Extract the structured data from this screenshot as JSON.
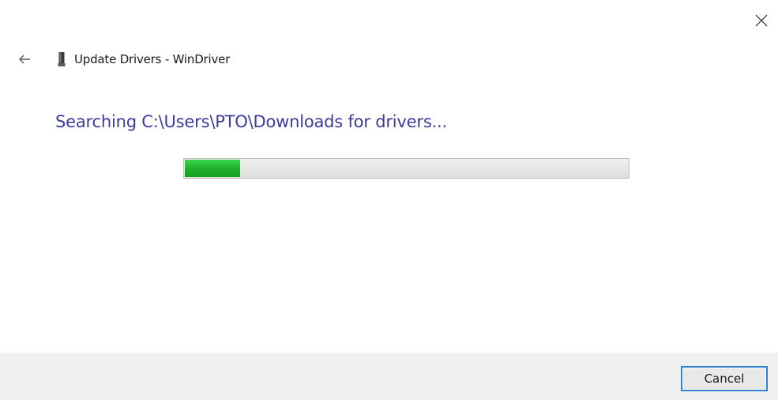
{
  "window": {
    "title": "Update Drivers - WinDriver",
    "close_icon": "close-icon",
    "back_icon": "back-arrow-icon",
    "device_icon": "device-icon"
  },
  "main": {
    "status_text": "Searching C:\\Users\\PTO\\Downloads for drivers...",
    "progress_fraction": 0.125
  },
  "footer": {
    "cancel_label": "Cancel"
  },
  "colors": {
    "status_text": "#3c3c9e",
    "progress_fill": "#1fae2c",
    "focus_border": "#2f7fd3"
  }
}
